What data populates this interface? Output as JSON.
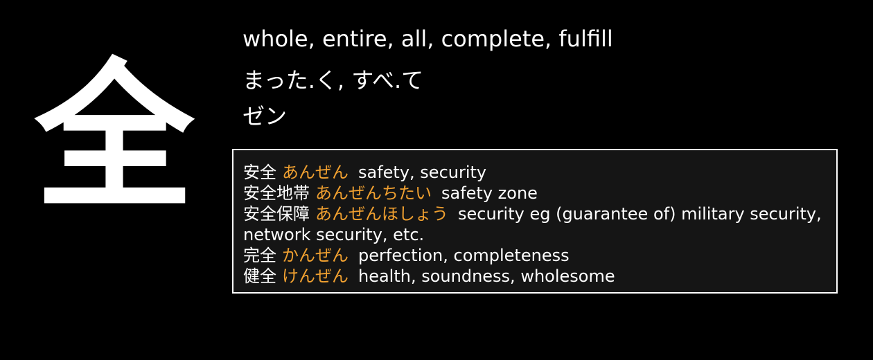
{
  "kanji": "全",
  "meanings": "whole, entire, all, complete, fulfill",
  "kun_readings": "まった.く, すべ.て",
  "on_readings": "ゼン",
  "colors": {
    "background": "#000000",
    "box_background": "#151515",
    "reading_accent": "#f0a030",
    "text": "#ffffff"
  },
  "vocabulary": [
    {
      "word": "安全",
      "reading": "あんぜん",
      "meaning": "safety, security"
    },
    {
      "word": "安全地帯",
      "reading": "あんぜんちたい",
      "meaning": "safety zone"
    },
    {
      "word": "安全保障",
      "reading": "あんぜんほしょう",
      "meaning": "security eg (guarantee of) military security, network security, etc."
    },
    {
      "word": "完全",
      "reading": "かんぜん",
      "meaning": "perfection, completeness"
    },
    {
      "word": "健全",
      "reading": "けんぜん",
      "meaning": "health, soundness, wholesome"
    }
  ]
}
